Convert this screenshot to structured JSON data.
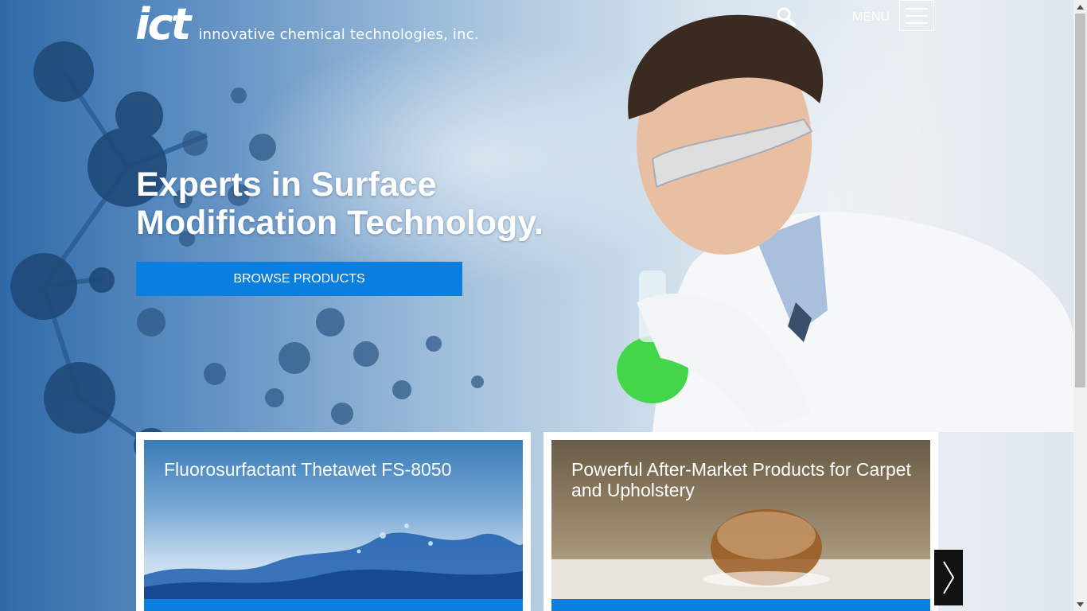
{
  "brand": {
    "logo_mark": "ict",
    "company_name": "innovative chemical technologies, inc."
  },
  "header": {
    "search_icon": "search-icon",
    "menu_label": "MENU",
    "menu_icon": "hamburger-icon"
  },
  "hero": {
    "headline_line1": "Experts in Surface",
    "headline_line2": "Modification Technology.",
    "browse_label": "BROWSE PRODUCTS"
  },
  "cards": [
    {
      "title": "Fluorosurfactant Thetawet FS-8050"
    },
    {
      "title": "Powerful After-Market Products for Carpet and Upholstery"
    }
  ],
  "carousel": {
    "next_icon": "chevron-right-icon"
  },
  "colors": {
    "accent": "#0a7fe0",
    "text_on_dark": "#ffffff",
    "arrow_bg": "#111111"
  }
}
